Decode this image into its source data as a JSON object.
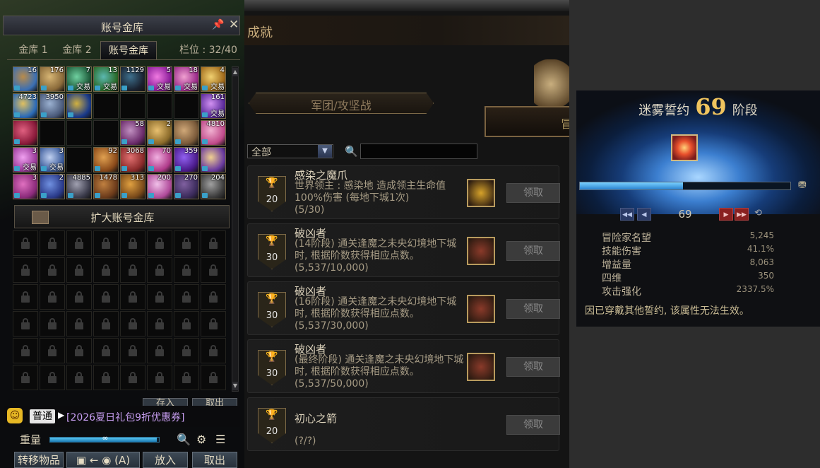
{
  "vault": {
    "title": "账号金库",
    "tabs": [
      "金库 1",
      "金库 2",
      "账号金库"
    ],
    "slots": "栏位 : 32/40",
    "items": [
      {
        "count": "16",
        "trade": "",
        "colors": [
          "#3a6fb4",
          "#b98b4a"
        ]
      },
      {
        "count": "176",
        "trade": "",
        "colors": [
          "#8a6a3a",
          "#d6b574"
        ]
      },
      {
        "count": "7",
        "trade": "交易",
        "colors": [
          "#1e5b3a",
          "#6fd0a0"
        ]
      },
      {
        "count": "13",
        "trade": "交易",
        "colors": [
          "#2a6b2a",
          "#5bb8b0"
        ]
      },
      {
        "count": "1129",
        "trade": "",
        "colors": [
          "#1a2230",
          "#3d6f8c"
        ]
      },
      {
        "count": "5",
        "trade": "交易",
        "colors": [
          "#8a1c9a",
          "#f07ae0"
        ]
      },
      {
        "count": "18",
        "trade": "交易",
        "colors": [
          "#9a2a8a",
          "#f0a0d0"
        ]
      },
      {
        "count": "4",
        "trade": "交易",
        "colors": [
          "#a06a1a",
          "#f0d070"
        ]
      },
      {
        "count": "4723",
        "trade": "",
        "colors": [
          "#2a6ab8",
          "#e0c060"
        ]
      },
      {
        "count": "3950",
        "trade": "",
        "colors": [
          "#4a5a7a",
          "#9ab0d0"
        ]
      },
      {
        "count": "",
        "trade": "",
        "colors": [
          "#1a3a8a",
          "#d0b040"
        ]
      },
      null,
      null,
      null,
      null,
      {
        "count": "161",
        "trade": "交易",
        "colors": [
          "#5a2a9a",
          "#d090f0"
        ]
      },
      {
        "count": "",
        "trade": "",
        "colors": [
          "#8a1a3a",
          "#e06080"
        ]
      },
      null,
      null,
      null,
      {
        "count": "58",
        "trade": "",
        "colors": [
          "#6a2a6a",
          "#c090c0"
        ]
      },
      {
        "count": "2",
        "trade": "",
        "colors": [
          "#8a6a2a",
          "#e8c070"
        ]
      },
      {
        "count": "",
        "trade": "",
        "colors": [
          "#7a5a3a",
          "#d0a878"
        ]
      },
      {
        "count": "4810",
        "trade": "",
        "colors": [
          "#c04a8a",
          "#f0b0d0"
        ]
      },
      {
        "count": "3",
        "trade": "交易",
        "colors": [
          "#9a3a9a",
          "#f0a0f0"
        ]
      },
      {
        "count": "3",
        "trade": "交易",
        "colors": [
          "#3a5a9a",
          "#c0d0f0"
        ]
      },
      null,
      {
        "count": "92",
        "trade": "",
        "colors": [
          "#8a4a1a",
          "#e0a050"
        ]
      },
      {
        "count": "3068",
        "trade": "",
        "colors": [
          "#8a2a2a",
          "#e07070"
        ]
      },
      {
        "count": "70",
        "trade": "",
        "colors": [
          "#b03a8a",
          "#f0b0e0"
        ]
      },
      {
        "count": "359",
        "trade": "",
        "colors": [
          "#4a1a8a",
          "#9060f0"
        ]
      },
      {
        "count": "",
        "trade": "",
        "colors": [
          "#6a3aa0",
          "#f0d090"
        ]
      },
      {
        "count": "3",
        "trade": "",
        "colors": [
          "#8a2a7a",
          "#e070c0"
        ]
      },
      {
        "count": "2",
        "trade": "",
        "colors": [
          "#2a3a8a",
          "#7090e0"
        ]
      },
      {
        "count": "4885",
        "trade": "",
        "colors": [
          "#3a3a4a",
          "#a0a0b0"
        ]
      },
      {
        "count": "1478",
        "trade": "",
        "colors": [
          "#6a3a1a",
          "#c08040"
        ]
      },
      {
        "count": "313",
        "trade": "",
        "colors": [
          "#7a4a1a",
          "#e0a040"
        ]
      },
      {
        "count": "200",
        "trade": "",
        "colors": [
          "#b04a9a",
          "#f0c0e8"
        ]
      },
      {
        "count": "270",
        "trade": "",
        "colors": [
          "#3a2a5a",
          "#8060a0"
        ]
      },
      {
        "count": "204",
        "trade": "",
        "colors": [
          "#3a3a3a",
          "#a0a0a0"
        ]
      }
    ],
    "expand_label": "扩大账号金库",
    "partial_buttons": [
      "存入",
      "取出"
    ],
    "chat": {
      "channel": "普通",
      "message": "[2026夏日礼包9折优惠券]"
    },
    "weight_label": "重量",
    "weight_value": "∞",
    "weight_fraction": 0.98,
    "bottom_buttons": [
      "转移物品",
      "放入",
      "取出"
    ],
    "bag_swap_label": "(A)"
  },
  "achievement": {
    "title": "成就",
    "ribbon": "军团/攻坚战",
    "right_tab": "冒",
    "filter": "全部",
    "search_value": "",
    "cards": [
      {
        "points": "20",
        "name": "感染之魔爪",
        "desc": "世界领主 : 感染地        造成领主生命值100%伤害 (每地下城1次)",
        "progress": "(5/30)",
        "claim": "领取",
        "icon_color": "#d6a22a"
      },
      {
        "points": "30",
        "name": "破凶者",
        "desc": "(14阶段) 通关逢魔之未央幻境地下城时, 根据阶数获得相应点数。",
        "progress": "(5,537/10,000)",
        "claim": "领取",
        "icon_color": "#8a3a2a"
      },
      {
        "points": "30",
        "name": "破凶者",
        "desc": "(16阶段) 通关逢魔之未央幻境地下城时, 根据阶数获得相应点数。",
        "progress": "(5,537/30,000)",
        "claim": "领取",
        "icon_color": "#8a3a2a"
      },
      {
        "points": "30",
        "name": "破凶者",
        "desc": "(最终阶段) 通关逢魔之未央幻境地下城时, 根据阶数获得相应点数。",
        "progress": "(5,537/50,000)",
        "claim": "领取",
        "icon_color": "#8a3a2a"
      },
      {
        "points": "20",
        "name": "初心之箭",
        "desc": "",
        "progress": "(?/?)",
        "claim": "领取",
        "icon_color": ""
      }
    ]
  },
  "pact": {
    "name": "迷雾誓约",
    "level": "69",
    "stage": "阶段",
    "progress_fraction": 0.49,
    "nav_level": "69",
    "stats": [
      {
        "label": "冒险家名望",
        "value": "5,245"
      },
      {
        "label": "技能伤害",
        "value": "41.1%"
      },
      {
        "label": "增益量",
        "value": "8,063"
      },
      {
        "label": "四维",
        "value": "350"
      },
      {
        "label": "攻击强化",
        "value": "2337.5%"
      }
    ],
    "note": "因已穿戴其他誓约,  该属性无法生效。"
  },
  "colors": {
    "accent_gold": "#f0c45e",
    "bar_blue": "#2a82d0",
    "trade_text": "#ffffff",
    "chat_purple": "#c79ef1"
  }
}
